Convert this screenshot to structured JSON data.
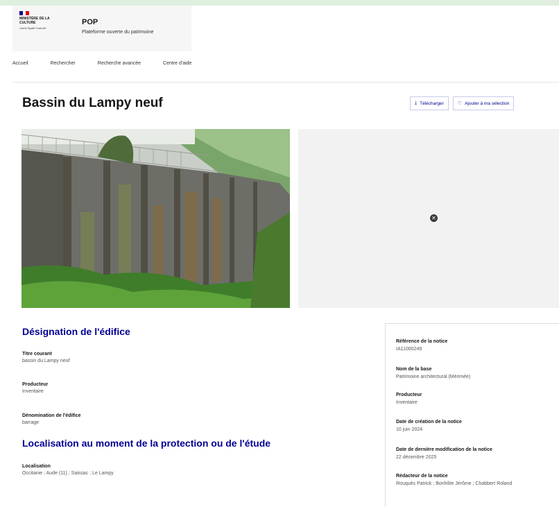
{
  "colors": {
    "accent_blue": "#000091",
    "flag_blue": "#000091",
    "flag_white": "#ffffff",
    "flag_red": "#e1000f",
    "top_strip": "#dfeedd"
  },
  "header": {
    "ministry": "Ministère de la Culture",
    "motto": "Liberté Égalité Fraternité",
    "site_title": "POP",
    "site_subtitle": "Plateforme ouverte du patrimoine"
  },
  "nav": {
    "items": [
      "Accueil",
      "Rechercher",
      "Recherche avancée",
      "Centre d'aide"
    ]
  },
  "page": {
    "title": "Bassin du Lampy neuf"
  },
  "actions": {
    "download": {
      "label": "Télécharger",
      "icon": "download-icon"
    },
    "add_selection": {
      "label": "Ajouter à ma sélection",
      "icon": "heart-icon"
    }
  },
  "map": {
    "marker_icon": "close-circle-icon"
  },
  "designation": {
    "section_title": "Désignation de l'édifice",
    "fields": [
      {
        "label": "Titre courant",
        "value": "bassin du Lampy neuf"
      },
      {
        "label": "Producteur",
        "value": "Inventaire"
      },
      {
        "label": "Dénomination de l'édifice",
        "value": "barrage"
      }
    ]
  },
  "localisation": {
    "section_title": "Localisation au moment de la protection ou de l'étude",
    "fields": [
      {
        "label": "Localisation",
        "value": "Occitanie ; Aude (11) ; Saissac ; Le Lampy"
      }
    ]
  },
  "notice": {
    "items": [
      {
        "label": "Référence de la notice",
        "value": "IA11000249"
      },
      {
        "label": "Nom de la base",
        "value": "Patrimoine architectural (Mérimée)"
      },
      {
        "label": "Producteur",
        "value": "Inventaire"
      },
      {
        "label": "Date de création de la notice",
        "value": "10 juin 2024"
      },
      {
        "label": "Date de dernière modification de la notice",
        "value": "22 décembre 2025"
      },
      {
        "label": "Rédacteur de la notice",
        "value": "Rouquès Patrick ; Bonhôte Jérôme ; Chabbert Roland"
      }
    ]
  }
}
